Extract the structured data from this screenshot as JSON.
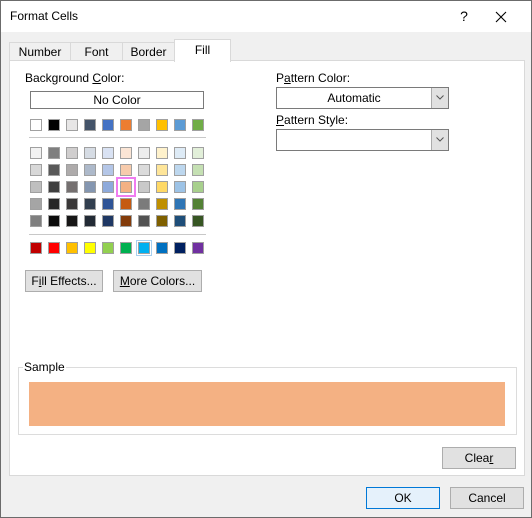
{
  "window": {
    "title": "Format Cells",
    "help_label": "?",
    "close_label": "✕"
  },
  "tabs": [
    {
      "label": "Number",
      "active": false
    },
    {
      "label": "Font",
      "active": false
    },
    {
      "label": "Border",
      "active": false
    },
    {
      "label": "Fill",
      "active": true
    }
  ],
  "fill": {
    "background_color_label_pre": "Background ",
    "background_color_label_accel": "C",
    "background_color_label_post": "olor:",
    "no_color_label": "No Color",
    "theme_row": [
      "#ffffff",
      "#000000",
      "#e7e6e6",
      "#44546a",
      "#4472c4",
      "#ed7d31",
      "#a5a5a5",
      "#ffc000",
      "#5b9bd5",
      "#70ad47"
    ],
    "tint_rows": [
      [
        "#f2f2f2",
        "#7f7f7f",
        "#d0cece",
        "#d6dce4",
        "#d9e2f3",
        "#fbe5d5",
        "#ededed",
        "#fff2cc",
        "#deebf6",
        "#e2efd9"
      ],
      [
        "#d8d8d8",
        "#595959",
        "#aeabab",
        "#adb9ca",
        "#b4c6e7",
        "#f7cbac",
        "#dbdbdb",
        "#fee599",
        "#bdd7ee",
        "#c5e0b3"
      ],
      [
        "#bfbfbf",
        "#3f3f3f",
        "#757070",
        "#8496b0",
        "#8eaadb",
        "#f4b183",
        "#c9c9c9",
        "#ffd966",
        "#9dc3e6",
        "#a8d08d"
      ],
      [
        "#a5a5a5",
        "#262626",
        "#3a3838",
        "#323f4f",
        "#2f5496",
        "#c55a11",
        "#7b7b7b",
        "#bf8f00",
        "#2e75b5",
        "#538135"
      ],
      [
        "#7f7f7f",
        "#0c0c0c",
        "#171616",
        "#222a35",
        "#1f3864",
        "#833c0b",
        "#525252",
        "#7f6000",
        "#1e4e79",
        "#375623"
      ]
    ],
    "selected_swatch": {
      "row": 2,
      "col": 5,
      "color": "#f4b183"
    },
    "standard_row": [
      "#c00000",
      "#ff0000",
      "#ffc000",
      "#ffff00",
      "#92d050",
      "#00b050",
      "#00b0f0",
      "#0070c0",
      "#002060",
      "#7030a0"
    ],
    "hovered_standard_index": 6,
    "fill_effects_pre": "F",
    "fill_effects_accel": "i",
    "fill_effects_post": "ll Effects...",
    "more_colors_accel": "M",
    "more_colors_post": "ore Colors...",
    "pattern_color_label_pre": "P",
    "pattern_color_label_accel": "a",
    "pattern_color_label_post": "ttern Color:",
    "pattern_color_value": "Automatic",
    "pattern_style_label_accel": "P",
    "pattern_style_label_post": "attern Style:",
    "pattern_style_value": "",
    "sample_label": "Sample",
    "sample_color": "#f4b183"
  },
  "buttons": {
    "clear_pre": "Clea",
    "clear_accel": "r",
    "ok": "OK",
    "cancel": "Cancel"
  }
}
